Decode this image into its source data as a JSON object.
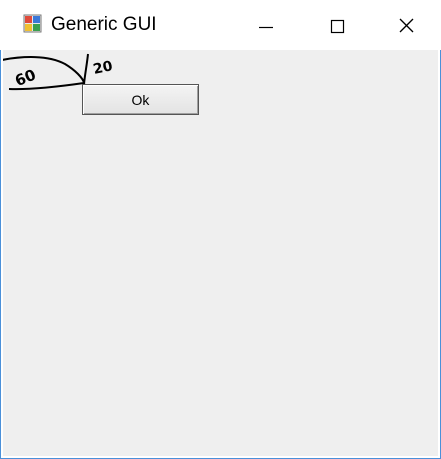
{
  "window": {
    "title": "Generic GUI",
    "icon": "winforms-app-icon"
  },
  "title_controls": {
    "minimize_icon": "minimize-icon",
    "maximize_icon": "maximize-icon",
    "close_icon": "close-icon"
  },
  "content": {
    "ok_label": "Ok",
    "sketch_label_left": "60",
    "sketch_label_right": "20"
  },
  "colors": {
    "client_background": "#efefef",
    "window_border": "#4a90d9"
  }
}
